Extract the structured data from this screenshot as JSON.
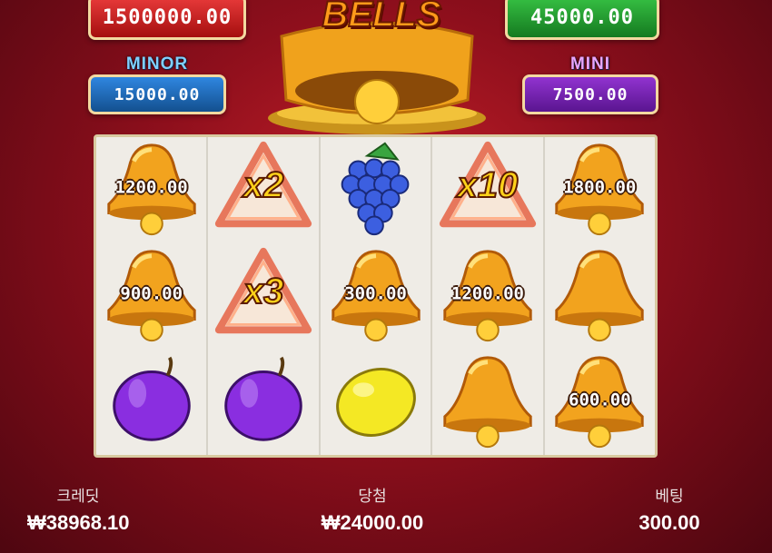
{
  "jackpots": {
    "grand": {
      "value": "1500000.00",
      "color": "#d11d1d"
    },
    "major": {
      "value": "45000.00",
      "color": "#1e9a2a"
    },
    "minor": {
      "label": "MINOR",
      "value": "15000.00",
      "color": "#1b6fc9"
    },
    "mini": {
      "label": "MINI",
      "value": "7500.00",
      "color": "#7a22b8"
    }
  },
  "logo": {
    "text": "BELLS"
  },
  "reels": [
    [
      {
        "symbol": "bell-icon",
        "value": "1200.00"
      },
      {
        "symbol": "bell-icon",
        "value": "900.00"
      },
      {
        "symbol": "plum-icon"
      }
    ],
    [
      {
        "symbol": "multiplier-icon",
        "value": "x2"
      },
      {
        "symbol": "multiplier-icon",
        "value": "x3"
      },
      {
        "symbol": "plum-icon"
      }
    ],
    [
      {
        "symbol": "grapes-icon"
      },
      {
        "symbol": "bell-icon",
        "value": "300.00"
      },
      {
        "symbol": "lemon-icon"
      }
    ],
    [
      {
        "symbol": "multiplier-icon",
        "value": "x10"
      },
      {
        "symbol": "bell-icon",
        "value": "1200.00"
      },
      {
        "symbol": "bell-icon"
      }
    ],
    [
      {
        "symbol": "bell-icon",
        "value": "1800.00"
      },
      {
        "symbol": "bell-icon"
      },
      {
        "symbol": "bell-icon",
        "value": "600.00"
      }
    ]
  ],
  "footer": {
    "credit_label": "크레딧",
    "credit_value": "₩38968.10",
    "win_label": "당첨",
    "win_value": "₩24000.00",
    "bet_label": "베팅",
    "bet_value": "300.00"
  }
}
